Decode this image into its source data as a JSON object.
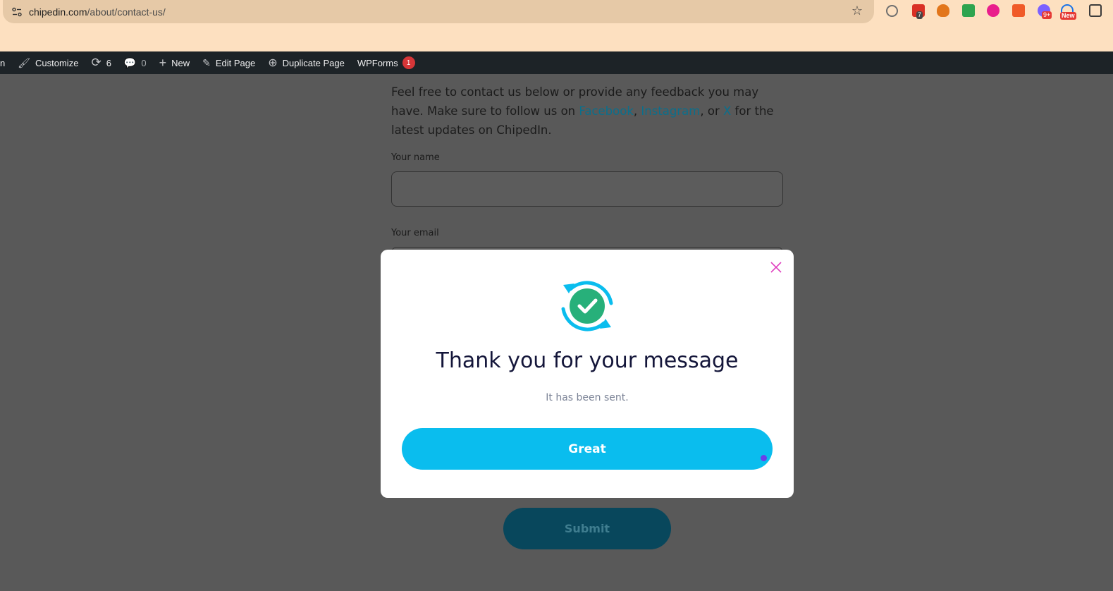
{
  "browser": {
    "url_domain": "chipedin.com",
    "url_path": "/about/contact-us/",
    "extensions": [
      {
        "name": "grammarly-icon",
        "color": "#6f6f6f"
      },
      {
        "name": "calendar-extension-icon",
        "color": "#d93025",
        "badge": "7"
      },
      {
        "name": "metamask-icon",
        "color": "#e2761b"
      },
      {
        "name": "green-extension-icon",
        "color": "#2ea44f"
      },
      {
        "name": "pink-extension-icon",
        "color": "#e91e8c"
      },
      {
        "name": "orange-extension-icon",
        "color": "#f05a28"
      },
      {
        "name": "colorful-extension-icon",
        "color": "#7b61ff",
        "badge": "9+"
      },
      {
        "name": "new-extension-icon",
        "color": "#1a73e8",
        "badge": "New"
      },
      {
        "name": "extensions-puzzle-icon",
        "color": "#3c3c3c"
      }
    ]
  },
  "admin_bar": {
    "partial": "n",
    "customize": "Customize",
    "updates_count": "6",
    "comments_count": "0",
    "new": "New",
    "edit_page": "Edit Page",
    "duplicate_page": "Duplicate Page",
    "wpforms": "WPForms",
    "wpforms_count": "1"
  },
  "page": {
    "intro_1": "Feel free to contact us below or provide any feedback you may have. Make sure to follow us on ",
    "link_facebook": "Facebook",
    "sep_1": ", ",
    "link_instagram": "Instagram",
    "sep_2": ", or ",
    "link_x": "X",
    "intro_2": " for the latest updates on ChipedIn.",
    "label_name": "Your name",
    "label_email": "Your email",
    "submit": "Submit"
  },
  "modal": {
    "title": "Thank you for your message",
    "subtitle": "It has been sent.",
    "button": "Great",
    "colors": {
      "accent": "#0abdee",
      "check": "#27b07a",
      "close": "#e040c0"
    }
  }
}
